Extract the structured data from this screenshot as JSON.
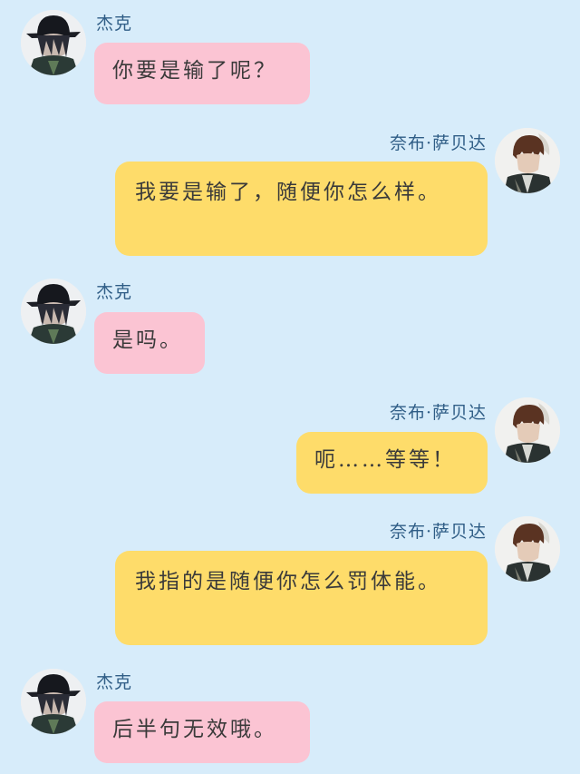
{
  "colors": {
    "background": "#d7ecfa",
    "left_bubble": "#fbc4d3",
    "right_bubble": "#fedc6a",
    "name_color": "#2f5d86"
  },
  "messages": [
    {
      "sender": "杰克",
      "text": "你要是输了呢？"
    },
    {
      "sender": "奈布·萨贝达",
      "text": "我要是输了，随便你怎么样。"
    },
    {
      "sender": "杰克",
      "text": "是吗。"
    },
    {
      "sender": "奈布·萨贝达",
      "text": "呃……等等！"
    },
    {
      "sender": "奈布·萨贝达",
      "text": "我指的是随便你怎么罚体能。"
    },
    {
      "sender": "杰克",
      "text": "后半句无效哦。"
    }
  ]
}
